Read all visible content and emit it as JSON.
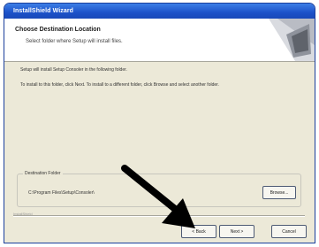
{
  "window": {
    "title": "InstallShield Wizard"
  },
  "header": {
    "title": "Choose Destination Location",
    "subtitle": "Select folder where Setup will install files."
  },
  "body": {
    "line1": "Setup will install Setup Consoler in the following folder.",
    "line2": "To install to this folder, click Next. To install to a different folder, click Browse and select another folder."
  },
  "destination": {
    "group_label": "Destination Folder",
    "path": "C:\\Program Files\\Setup\\Consoler\\",
    "browse_label": "Browse..."
  },
  "footer": {
    "brand": "InstallShield",
    "back_label": "< Back",
    "next_label": "Next >",
    "cancel_label": "Cancel"
  },
  "colors": {
    "titlebar": "#1c52c9",
    "dialog_bg": "#ece9d8",
    "arrow": "#000000"
  }
}
